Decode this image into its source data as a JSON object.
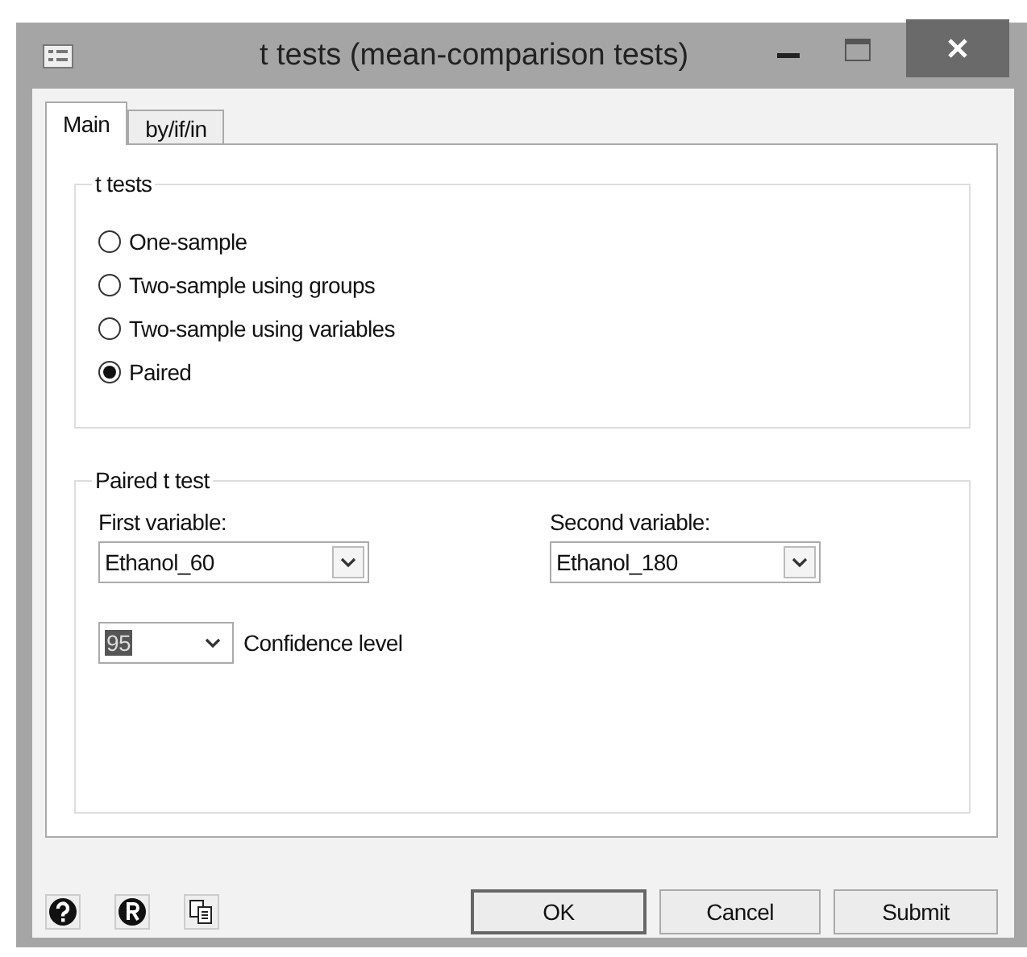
{
  "window": {
    "title": "t tests (mean-comparison tests)"
  },
  "tabs": [
    {
      "label": "Main",
      "selected": true
    },
    {
      "label": "by/if/in",
      "selected": false
    }
  ],
  "test_group": {
    "title": "t tests",
    "options": [
      {
        "label": "One-sample",
        "selected": false
      },
      {
        "label": "Two-sample using groups",
        "selected": false
      },
      {
        "label": "Two-sample using variables",
        "selected": false
      },
      {
        "label": "Paired",
        "selected": true
      }
    ]
  },
  "paired_group": {
    "title": "Paired t test",
    "first_variable": {
      "label": "First variable:",
      "value": "Ethanol_60"
    },
    "second_variable": {
      "label": "Second variable:",
      "value": "Ethanol_180"
    },
    "confidence": {
      "value": "95",
      "value_selected": true,
      "label": "Confidence level"
    }
  },
  "buttons": [
    {
      "label": "OK",
      "default": true
    },
    {
      "label": "Cancel",
      "default": false
    },
    {
      "label": "Submit",
      "default": false
    }
  ]
}
